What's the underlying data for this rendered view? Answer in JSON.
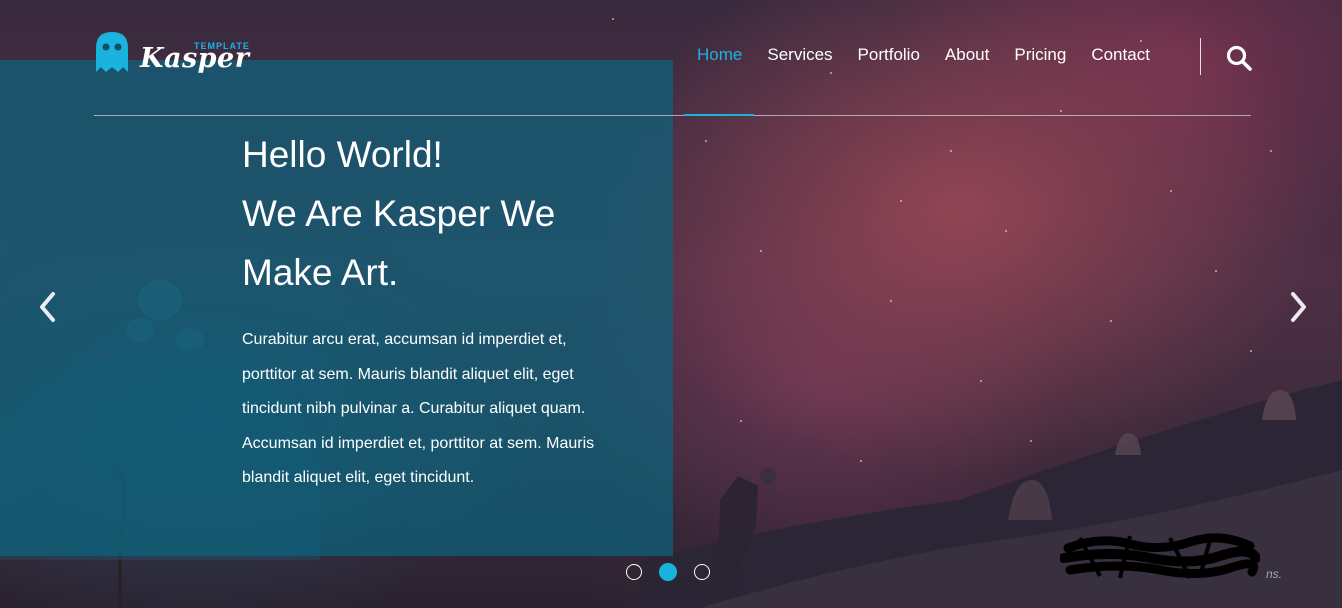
{
  "brand": {
    "name": "Kasper",
    "tagline": "TEMPLATE",
    "accent_color": "#1ab3df",
    "logo_icon": "ghost-icon"
  },
  "nav": {
    "items": [
      {
        "label": "Home",
        "active": true
      },
      {
        "label": "Services",
        "active": false
      },
      {
        "label": "Portfolio",
        "active": false
      },
      {
        "label": "About",
        "active": false
      },
      {
        "label": "Pricing",
        "active": false
      },
      {
        "label": "Contact",
        "active": false
      }
    ],
    "search_icon": "search-icon"
  },
  "hero": {
    "title_lines": [
      "Hello World!",
      "We Are Kasper We",
      "Make Art."
    ],
    "text": "Curabitur arcu erat, accumsan id imperdiet et, porttitor at sem. Mauris blandit aliquet elit, eget tincidunt nibh pulvinar a. Curabitur aliquet quam. Accumsan id imperdiet et, porttitor at sem. Mauris blandit aliquet elit, eget tincidunt.",
    "panel_color": "#0d627c"
  },
  "slider": {
    "prev_icon": "chevron-left-icon",
    "next_icon": "chevron-right-icon",
    "slide_count": 3,
    "active_slide": 2
  },
  "credit": {
    "text": "ns."
  }
}
